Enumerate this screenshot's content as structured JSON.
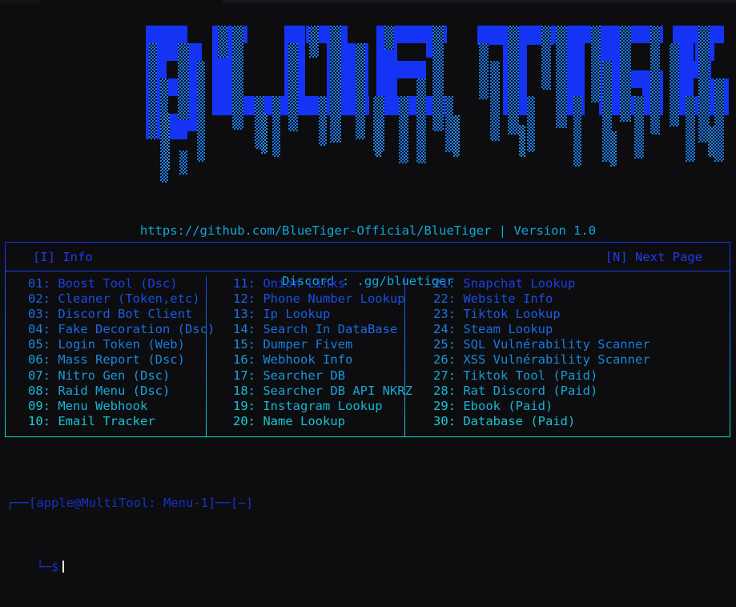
{
  "window": {
    "title_strip": ""
  },
  "banner": {
    "ascii_art_text": "BLUE TIGER",
    "style": "dripping-blocky-ascii",
    "color_primary": "#1433f5",
    "color_drip": "#1a7ef0"
  },
  "subtitle": {
    "line1": "https://github.com/BlueTiger-Official/BlueTiger | Version 1.0",
    "line2": "Discord : .gg/bluetiger",
    "color": "#12a5d6"
  },
  "menu": {
    "header": {
      "left": "[I] Info",
      "right": "[N] Next Page",
      "color": "#1f3ce8"
    },
    "border_color_top": "#1433ef",
    "border_color_bottom": "#16d8d0",
    "columns": [
      {
        "items": [
          {
            "num": "01:",
            "label": "Boost Tool (Dsc)"
          },
          {
            "num": "02:",
            "label": "Cleaner (Token,etc)"
          },
          {
            "num": "03:",
            "label": "Discord Bot Client"
          },
          {
            "num": "04:",
            "label": "Fake Decoration (Dsc)"
          },
          {
            "num": "05:",
            "label": "Login Token (Web)"
          },
          {
            "num": "06:",
            "label": "Mass Report (Dsc)"
          },
          {
            "num": "07:",
            "label": "Nitro Gen (Dsc)"
          },
          {
            "num": "08:",
            "label": "Raid Menu (Dsc)"
          },
          {
            "num": "09:",
            "label": "Menu Webhook"
          },
          {
            "num": "10:",
            "label": "Email Tracker"
          }
        ]
      },
      {
        "items": [
          {
            "num": "11:",
            "label": "Onion Links"
          },
          {
            "num": "12:",
            "label": "Phone Number Lookup"
          },
          {
            "num": "13:",
            "label": "Ip Lookup"
          },
          {
            "num": "14:",
            "label": "Search In DataBase"
          },
          {
            "num": "15:",
            "label": "Dumper Fivem"
          },
          {
            "num": "16:",
            "label": "Webhook Info"
          },
          {
            "num": "17:",
            "label": "Searcher DB"
          },
          {
            "num": "18:",
            "label": "Searcher DB API NKRZ"
          },
          {
            "num": "19:",
            "label": "Instagram Lookup"
          },
          {
            "num": "20:",
            "label": "Name Lookup"
          }
        ]
      },
      {
        "items": [
          {
            "num": "21:",
            "label": "Snapchat Lookup"
          },
          {
            "num": "22:",
            "label": "Website Info"
          },
          {
            "num": "23:",
            "label": "Tiktok Lookup"
          },
          {
            "num": "24:",
            "label": "Steam Lookup"
          },
          {
            "num": "25:",
            "label": "SQL Vulnérability Scanner"
          },
          {
            "num": "26:",
            "label": "XSS Vulnérability Scanner"
          },
          {
            "num": "27:",
            "label": "Tiktok Tool (Paid)"
          },
          {
            "num": "28:",
            "label": "Rat Discord (Paid)"
          },
          {
            "num": "29:",
            "label": "Ebook (Paid)"
          },
          {
            "num": "30:",
            "label": "Database (Paid)"
          }
        ]
      }
    ]
  },
  "prompt": {
    "line1": "┌──[apple@MultiTool: Menu-1]──[~]",
    "line2": "└─$",
    "input_value": "",
    "color": "#1433c8",
    "cursor_color": "#e8e8e8"
  }
}
